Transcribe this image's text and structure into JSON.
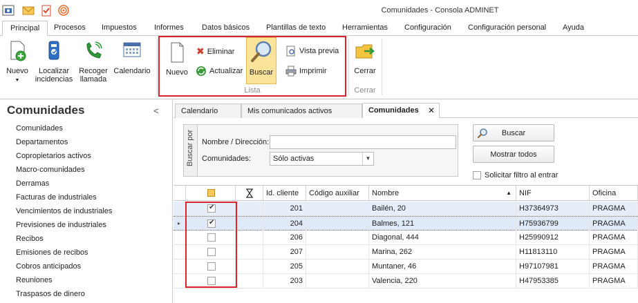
{
  "window": {
    "title": "Comunidades - Consola ADMINET"
  },
  "quick_access": [
    {
      "icon": "app-logo-icon"
    },
    {
      "icon": "mail-icon"
    },
    {
      "icon": "clipboard-check-icon"
    },
    {
      "icon": "broadcast-icon"
    }
  ],
  "ribbon_tabs": [
    {
      "label": "Principal",
      "active": true
    },
    {
      "label": "Procesos"
    },
    {
      "label": "Impuestos"
    },
    {
      "label": "Informes"
    },
    {
      "label": "Datos básicos"
    },
    {
      "label": "Plantillas de texto"
    },
    {
      "label": "Herramientas"
    },
    {
      "label": "Configuración"
    },
    {
      "label": "Configuración personal"
    },
    {
      "label": "Ayuda"
    }
  ],
  "ribbon": {
    "nuevo_dropdown": "Nuevo",
    "localizar": "Localizar\nincidencias",
    "recoger": "Recoger\nllamada",
    "calendario": "Calendario",
    "lista": {
      "nuevo": "Nuevo",
      "eliminar": "Eliminar",
      "actualizar": "Actualizar",
      "buscar": "Buscar",
      "vista_previa": "Vista previa",
      "imprimir": "Imprimir",
      "group_label": "Lista"
    },
    "cerrar": {
      "button": "Cerrar",
      "group_label": "Cerrar"
    }
  },
  "left_panel": {
    "title": "Comunidades",
    "collapse_glyph": "<",
    "items": [
      "Comunidades",
      "Departamentos",
      "Copropietarios activos",
      "Macro-comunidades",
      "Derramas",
      "Facturas de industriales",
      "Vencimientos de industriales",
      "Previsiones de industriales",
      "Recibos",
      "Emisiones de recibos",
      "Cobros anticipados",
      "Reuniones",
      "Traspasos de dinero"
    ]
  },
  "doc_tabs": [
    {
      "label": "Calendario"
    },
    {
      "label": "Mis comunicados activos"
    },
    {
      "label": "Comunidades",
      "active": true,
      "close": "✕"
    }
  ],
  "search": {
    "group_label": "Buscar por",
    "name_label": "Nombre / Dirección:",
    "name_value": "",
    "comunidades_label": "Comunidades:",
    "comunidades_value": "Sólo activas",
    "buscar_button": "Buscar",
    "mostrar_button": "Mostrar todos",
    "solicitar_label": "Solicitar filtro al entrar",
    "solicitar_checked": false
  },
  "grid": {
    "columns": [
      "",
      "",
      "Id. cliente",
      "Código auxiliar",
      "Nombre",
      "NIF",
      "Oficina"
    ],
    "sort_glyph": "▲",
    "rows": [
      {
        "checked": true,
        "id": "201",
        "aux": "",
        "nombre": "Bailén, 20",
        "nif": "H37364973",
        "oficina": "PRAGMA"
      },
      {
        "checked": true,
        "id": "204",
        "aux": "",
        "nombre": "Balmes, 121",
        "nif": "H75936799",
        "oficina": "PRAGMA",
        "current": true
      },
      {
        "checked": false,
        "id": "206",
        "aux": "",
        "nombre": "Diagonal, 444",
        "nif": "H25990912",
        "oficina": "PRAGMA"
      },
      {
        "checked": false,
        "id": "207",
        "aux": "",
        "nombre": "Marina, 262",
        "nif": "H11813110",
        "oficina": "PRAGMA"
      },
      {
        "checked": false,
        "id": "205",
        "aux": "",
        "nombre": "Muntaner, 46",
        "nif": "H97107981",
        "oficina": "PRAGMA"
      },
      {
        "checked": false,
        "id": "203",
        "aux": "",
        "nombre": "Valencia, 220",
        "nif": "H47953385",
        "oficina": "PRAGMA"
      }
    ]
  }
}
